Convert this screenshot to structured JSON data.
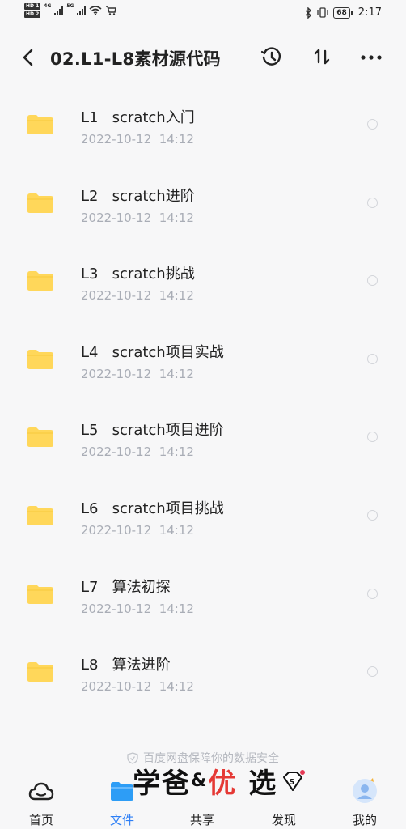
{
  "status_bar": {
    "hd1": "HD 1",
    "hd2": "HD 2",
    "net1": "4G",
    "net2": "5G",
    "battery": "68",
    "time": "2:17"
  },
  "header": {
    "title": "02.L1-L8素材源代码",
    "sort_glyph": "↿⇂"
  },
  "files": [
    {
      "name": "L1   scratch入门",
      "time": "2022-10-12  14:12"
    },
    {
      "name": "L2   scratch进阶",
      "time": "2022-10-12  14:12"
    },
    {
      "name": "L3   scratch挑战",
      "time": "2022-10-12  14:12"
    },
    {
      "name": "L4   scratch项目实战",
      "time": "2022-10-12  14:12"
    },
    {
      "name": "L5   scratch项目进阶",
      "time": "2022-10-12  14:12"
    },
    {
      "name": "L6   scratch项目挑战",
      "time": "2022-10-12  14:12"
    },
    {
      "name": "L7   算法初探",
      "time": "2022-10-12  14:12"
    },
    {
      "name": "L8   算法进阶",
      "time": "2022-10-12  14:12"
    }
  ],
  "footer": {
    "safety_note": "百度网盘保障你的数据安全"
  },
  "tabs": [
    {
      "label": "首页"
    },
    {
      "label": "文件"
    },
    {
      "label": "共享"
    },
    {
      "label": "发现"
    },
    {
      "label": "我的"
    }
  ],
  "watermark": {
    "part1": "学爸",
    "part2": "&",
    "part3": "优",
    "part4": "选",
    "badge": "S"
  },
  "colors": {
    "folder": "#ffd75a",
    "accent": "#2d7ff6",
    "timestamp": "#a9adb6"
  },
  "icons": {
    "back": "chevron-left-icon",
    "history": "history-clock-icon",
    "sort": "sort-icon",
    "more": "more-dots-icon",
    "folder": "folder-icon"
  }
}
